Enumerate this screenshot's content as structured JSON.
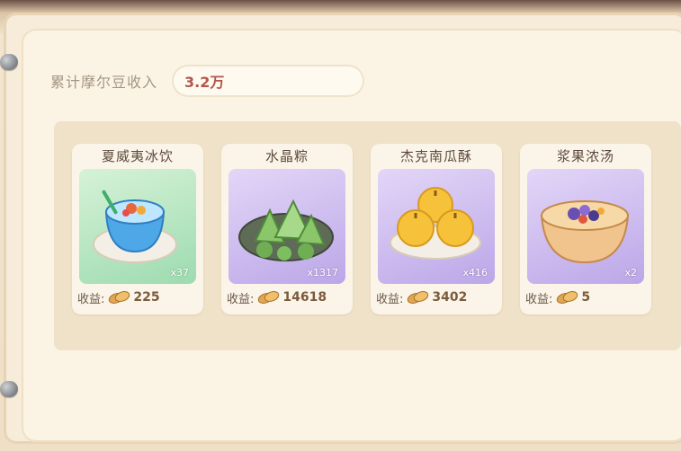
{
  "income": {
    "label": "累计摩尔豆收入",
    "value": "3.2万"
  },
  "earn_label": "收益:",
  "items": [
    {
      "name": "夏威夷冰饮",
      "quantity": "x37",
      "earning": "225",
      "icon": "shaved-ice-drink-icon"
    },
    {
      "name": "水晶粽",
      "quantity": "x1317",
      "earning": "14618",
      "icon": "crystal-zongzi-icon"
    },
    {
      "name": "杰克南瓜酥",
      "quantity": "x416",
      "earning": "3402",
      "icon": "pumpkin-pastry-icon"
    },
    {
      "name": "浆果浓汤",
      "quantity": "x2",
      "earning": "5",
      "icon": "berry-soup-icon"
    }
  ],
  "colors": {
    "accent_text": "#b2574c",
    "green_bg": "#9ddbb0",
    "purple_bg": "#bba7e8"
  }
}
